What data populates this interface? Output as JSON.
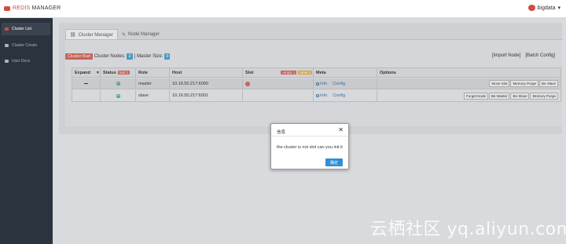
{
  "app": {
    "brand_hl": "REDIS",
    "brand_rest": " MANAGER",
    "user": "bigdata",
    "user_caret": "▾"
  },
  "sidebar": {
    "items": [
      {
        "label": "Cluster List",
        "icon": "cluster-icon",
        "active": true
      },
      {
        "label": "Cluster Create",
        "icon": "create-icon",
        "active": false
      },
      {
        "label": "User Docs",
        "icon": "docs-icon",
        "active": false
      }
    ]
  },
  "tabs": [
    {
      "label": "Cluster Manager",
      "icon": "link-icon",
      "glyph": "⛓",
      "active": true
    },
    {
      "label": "Node Manager",
      "icon": "wrench-icon",
      "glyph": "✎",
      "active": false
    }
  ],
  "info": {
    "status_badge": "Cluster Bad",
    "nodes_label": "Cluster Nodes:",
    "nodes_count": "2",
    "sep": "|",
    "master_label": "Master Size:",
    "master_count": "0",
    "import_link": "[Import Node]",
    "batch_link": "[Batch Config]"
  },
  "table": {
    "headers": {
      "expand": "Expand",
      "status": "Status",
      "status_tag": "bad 1",
      "role": "Role",
      "host": "Host",
      "slot": "Slot",
      "slot_tag_empty": "empty 1",
      "slot_tag_more": "more 1",
      "meta": "Meta",
      "options": "Options"
    },
    "rows": [
      {
        "role": "master",
        "host": "10.16.50.217:6000",
        "info": "Info",
        "config": "Config",
        "options": [
          "Move Slot",
          "Memory Purge",
          "Be Slave"
        ]
      },
      {
        "role": "slave",
        "host": "10.16.50.217:6001",
        "info": "Info",
        "config": "Config",
        "options": [
          "Forget Node",
          "Be Master",
          "Be Slave",
          "Memory Purge"
        ]
      }
    ]
  },
  "modal": {
    "title": "信息",
    "close": "✕",
    "message": "the cluster is not slot can you init it",
    "ok": "确定"
  },
  "watermark": "云栖社区 yq.aliyun.com",
  "colors": {
    "accent": "#d04b40",
    "sidebar": "#2b333e",
    "primary_btn": "#2f8fd7"
  }
}
